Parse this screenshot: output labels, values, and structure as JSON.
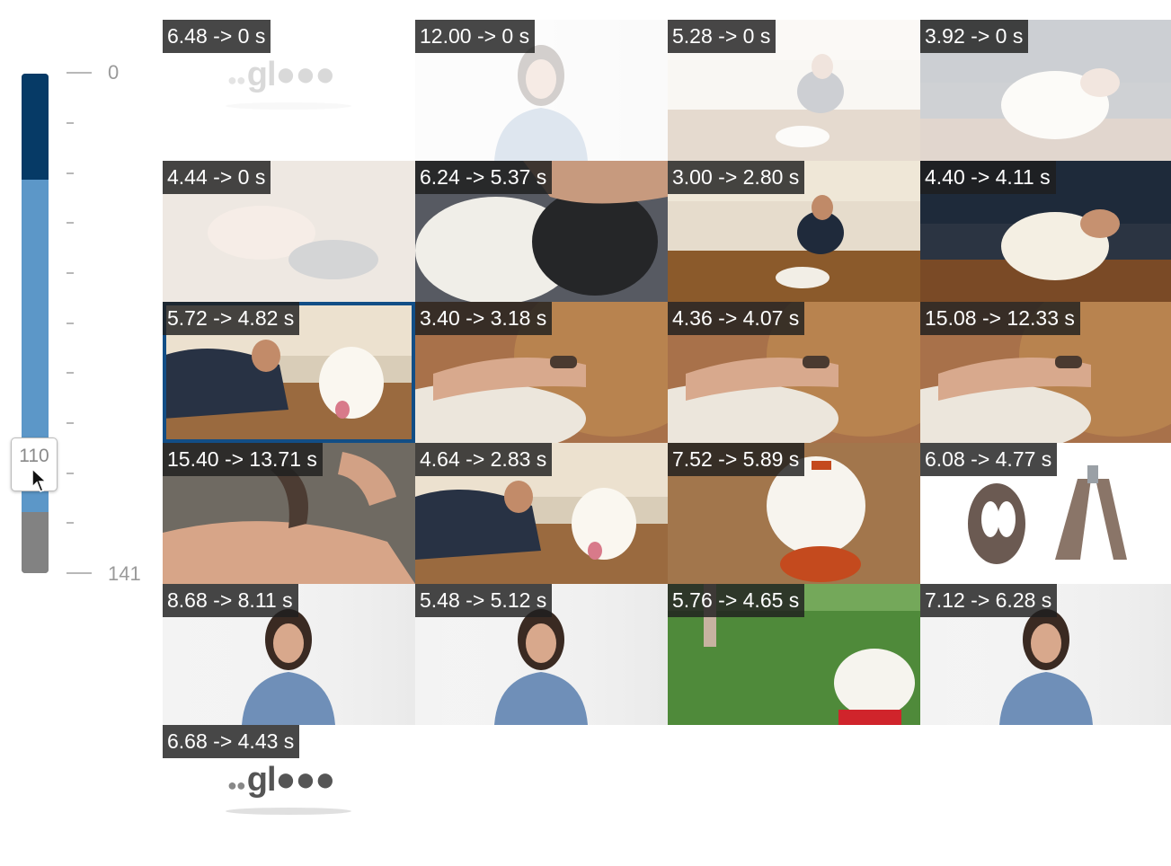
{
  "slider": {
    "min_label": "0",
    "max_label": "141",
    "value_label": "110",
    "min": 0,
    "max": 141,
    "value": 110
  },
  "grid": {
    "cells": [
      {
        "label": "6.48 -> 0 s",
        "scene": "logo",
        "faded": true
      },
      {
        "label": "12.00 -> 0 s",
        "scene": "presenter",
        "faded": true
      },
      {
        "label": "5.28 -> 0 s",
        "scene": "room",
        "faded": true
      },
      {
        "label": "3.92 -> 0 s",
        "scene": "dog-lap",
        "faded": true
      },
      {
        "label": "4.44 -> 0 s",
        "scene": "hands",
        "faded": true
      },
      {
        "label": "6.24 -> 5.37 s",
        "scene": "fur-closeup",
        "faded": false
      },
      {
        "label": "3.00 -> 2.80 s",
        "scene": "room",
        "faded": false
      },
      {
        "label": "4.40 -> 4.11 s",
        "scene": "dog-lap",
        "faded": false
      },
      {
        "label": "5.72 -> 4.82 s",
        "scene": "floor-dog",
        "faded": false,
        "selected": true
      },
      {
        "label": "3.40 -> 3.18 s",
        "scene": "paw-clip",
        "faded": false
      },
      {
        "label": "4.36 -> 4.07 s",
        "scene": "paw-clip",
        "faded": false
      },
      {
        "label": "15.08 -> 12.33 s",
        "scene": "paw-clip",
        "faded": false
      },
      {
        "label": "15.40 -> 13.71 s",
        "scene": "clipper-hands",
        "faded": false
      },
      {
        "label": "4.64 -> 2.83 s",
        "scene": "floor-dog",
        "faded": false
      },
      {
        "label": "7.52 -> 5.89 s",
        "scene": "white-dog-toy",
        "faded": false
      },
      {
        "label": "6.08 -> 4.77 s",
        "scene": "clippers",
        "faded": false
      },
      {
        "label": "8.68 -> 8.11 s",
        "scene": "presenter",
        "faded": false
      },
      {
        "label": "5.48 -> 5.12 s",
        "scene": "presenter",
        "faded": false
      },
      {
        "label": "5.76 -> 4.65 s",
        "scene": "grass-dog",
        "faded": false
      },
      {
        "label": "7.12 -> 6.28 s",
        "scene": "presenter",
        "faded": false
      },
      {
        "label": "6.68 -> 4.43 s",
        "scene": "logo",
        "faded": false
      }
    ]
  },
  "colors": {
    "slider_dark": "#063a66",
    "slider_light": "#5c97c8",
    "slider_gray": "#828282",
    "selection": "#124e86"
  }
}
